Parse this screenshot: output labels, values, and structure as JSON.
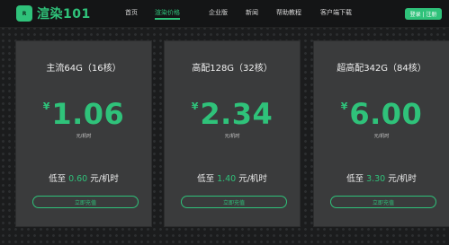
{
  "header": {
    "logo_mark": "R",
    "logo_text": "渲染101",
    "nav": [
      "首页",
      "渲染价格",
      "企业版",
      "新闻",
      "帮助教程",
      "客户端下载"
    ],
    "active_index": 1,
    "login_label": "登录 | 注册"
  },
  "cards": [
    {
      "title": "主流64G（16核）",
      "currency": "¥",
      "price": "1.06",
      "unit": "元/机时",
      "low_prefix": "低至",
      "low_value": "0.60",
      "low_suffix": "元/机时",
      "button": "立即充值"
    },
    {
      "title": "高配128G（32核）",
      "currency": "¥",
      "price": "2.34",
      "unit": "元/机时",
      "low_prefix": "低至",
      "low_value": "1.40",
      "low_suffix": "元/机时",
      "button": "立即充值"
    },
    {
      "title": "超高配342G（84核）",
      "currency": "¥",
      "price": "6.00",
      "unit": "元/机时",
      "low_prefix": "低至",
      "low_value": "3.30",
      "low_suffix": "元/机时",
      "button": "立即充值"
    }
  ],
  "colors": {
    "accent": "#2fc27a",
    "background": "#1b1c1d",
    "card": "#3a3b3c"
  }
}
